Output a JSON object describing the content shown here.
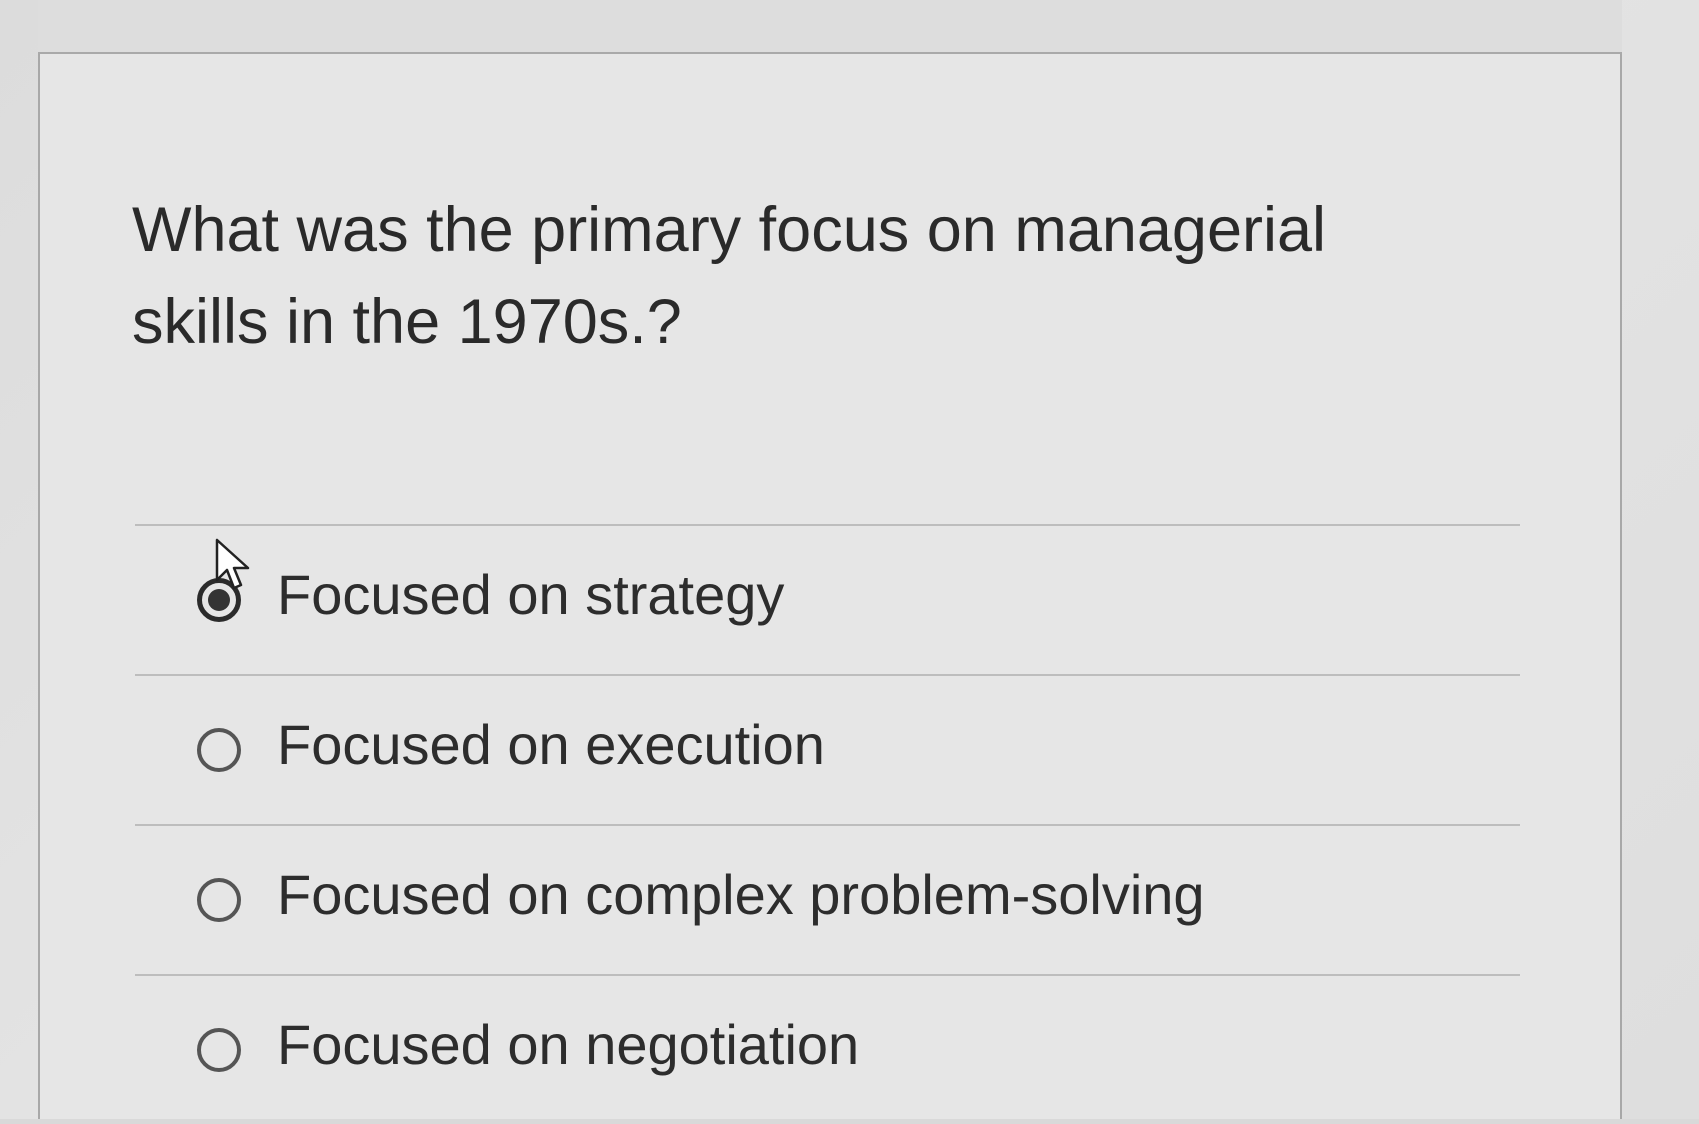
{
  "question": {
    "line1": "What was the primary focus on managerial",
    "line2": "skills in the 1970s.?"
  },
  "options": [
    {
      "label": "Focused on strategy",
      "selected": true
    },
    {
      "label": "Focused on execution",
      "selected": false
    },
    {
      "label": "Focused on complex problem-solving",
      "selected": false
    },
    {
      "label": "Focused on negotiation",
      "selected": false
    }
  ],
  "colors": {
    "background": "#e6e6e6",
    "text": "#2d2d2d",
    "divider": "#bdbdbd",
    "radio_border": "#555555"
  },
  "icons": {
    "cursor": "mouse-pointer-icon"
  }
}
